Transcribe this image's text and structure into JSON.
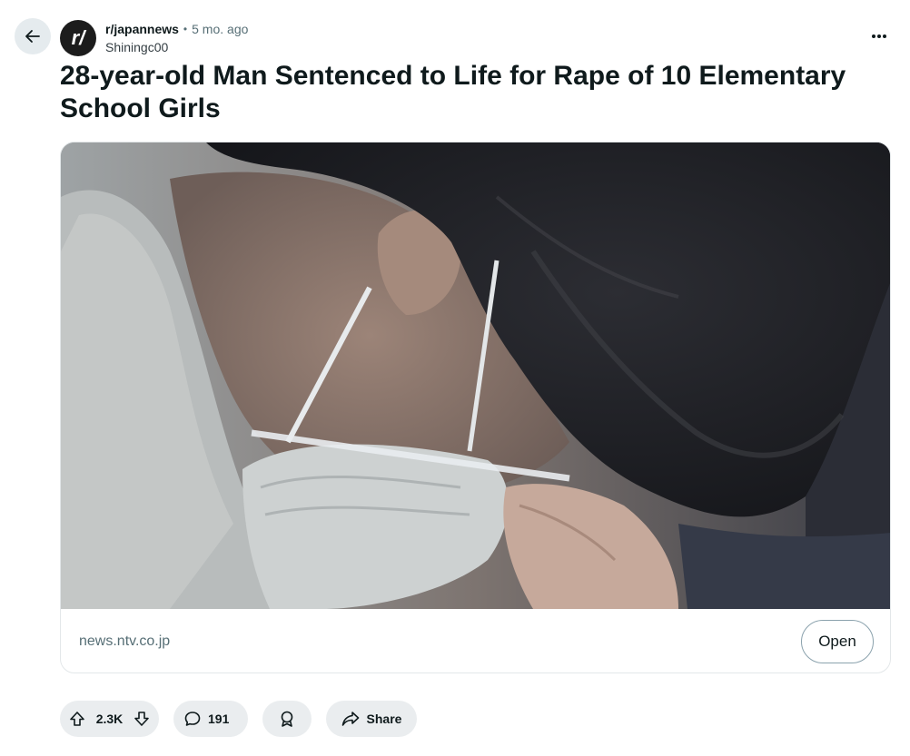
{
  "post": {
    "subreddit": "r/japannews",
    "subreddit_avatar_text": "r/",
    "separator": "•",
    "age": "5 mo. ago",
    "author": "Shiningc00",
    "title": "28-year-old Man Sentenced to Life for Rape of 10 Elementary School Girls"
  },
  "link_card": {
    "domain": "news.ntv.co.jp",
    "open_label": "Open"
  },
  "actions": {
    "score": "2.3K",
    "comments": "191",
    "share_label": "Share"
  },
  "colors": {
    "pill_bg": "#eaedef",
    "back_bg": "#e5ebee",
    "meta_gray": "#576f76"
  },
  "icons": [
    "back-arrow-icon",
    "more-options-icon",
    "upvote-icon",
    "downvote-icon",
    "comment-icon",
    "award-icon",
    "share-icon"
  ]
}
